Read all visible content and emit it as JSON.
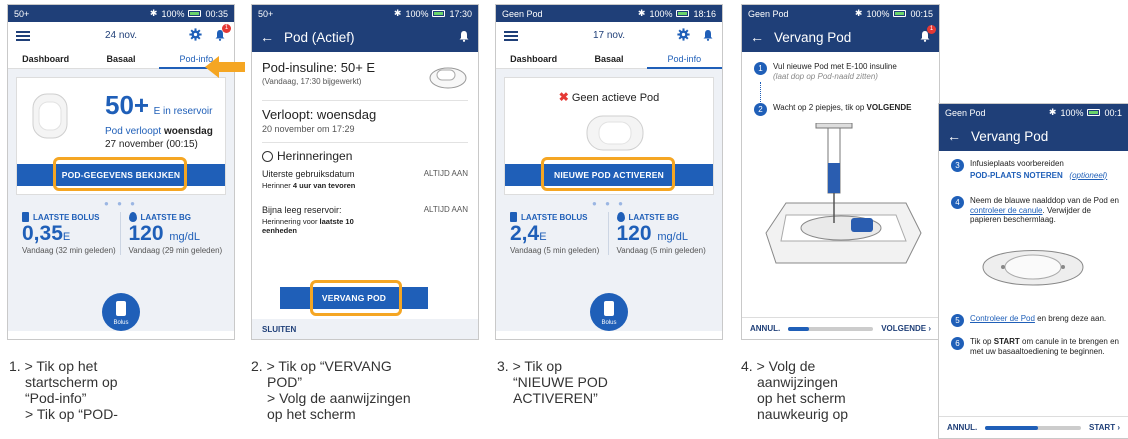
{
  "screen1": {
    "status_left": "50+",
    "status_right": "100%",
    "status_time": "00:35",
    "date": "24 nov.",
    "tabs": [
      "Dashboard",
      "Basaal",
      "Pod-info"
    ],
    "reservoir_value": "50+",
    "reservoir_unit": "E in reservoir",
    "expiry_line1": "Pod verloopt",
    "expiry_day": "woensdag",
    "expiry_line2": "27 november (00:15)",
    "button": "POD-GEGEVENS BEKIJKEN",
    "last_bolus_label": "LAATSTE BOLUS",
    "last_bolus_value": "0,35",
    "last_bolus_unit": "E",
    "last_bolus_sub": "Vandaag (32 min geleden)",
    "last_bg_label": "LAATSTE BG",
    "last_bg_value": "120",
    "last_bg_unit": "mg/dL",
    "last_bg_sub": "Vandaag (29 min geleden)",
    "bolus_label": "Bolus",
    "badge": "1"
  },
  "screen2": {
    "status_left": "50+",
    "status_right": "100%",
    "status_time": "17:30",
    "title": "Pod (Actief)",
    "insulin_line": "Pod-insuline: 50+ E",
    "insulin_sub": "(Vandaag, 17:30 bijgewerkt)",
    "expiry_title": "Verloopt: woensdag",
    "expiry_sub": "20 november om 17:29",
    "reminders_title": "Herinneringen",
    "rem1_title": "Uiterste gebruiksdatum",
    "rem1_value": "ALTIJD AAN",
    "rem1_sub_pre": "Herinner",
    "rem1_sub_bold": "4 uur van tevoren",
    "rem2_title": "Bijna leeg reservoir:",
    "rem2_value": "ALTIJD AAN",
    "rem2_sub_pre": "Herinnering voor",
    "rem2_sub_bold": "laatste 10 eenheden",
    "button": "VERVANG POD",
    "close": "SLUITEN"
  },
  "screen3": {
    "status_left": "Geen Pod",
    "status_right": "100%",
    "status_time": "18:16",
    "date": "17 nov.",
    "tabs": [
      "Dashboard",
      "Basaal",
      "Pod-info"
    ],
    "no_pod": "Geen actieve Pod",
    "button": "NIEUWE POD ACTIVEREN",
    "last_bolus_label": "LAATSTE BOLUS",
    "last_bolus_value": "2,4",
    "last_bolus_unit": "E",
    "last_bolus_sub": "Vandaag (5 min geleden)",
    "last_bg_label": "LAATSTE BG",
    "last_bg_value": "120",
    "last_bg_unit": "mg/dL",
    "last_bg_sub": "Vandaag (5 min geleden)",
    "bolus_label": "Bolus"
  },
  "screen4": {
    "status_left": "Geen Pod",
    "status_right": "100%",
    "status_time": "00:15",
    "title": "Vervang Pod",
    "step1_num": "1",
    "step1": "Vul nieuwe Pod met E-100 insuline",
    "step1_sub": "(laat dop op Pod-naald zitten)",
    "step2_num": "2",
    "step2_pre": "Wacht op 2 piepjes, tik op",
    "step2_bold": "VOLGENDE",
    "cancel": "ANNUL.",
    "next": "VOLGENDE",
    "progress": 0.25,
    "badge": "1"
  },
  "screen5": {
    "status_left": "Geen Pod",
    "status_right": "100%",
    "status_time": "00:1",
    "title": "Vervang Pod",
    "step3_num": "3",
    "step3": "Infusieplaats voorbereiden",
    "step3_bold": "POD-PLAATS NOTEREN",
    "step3_optional": "(optioneel)",
    "step4_num": "4",
    "step4_pre": "Neem de blauwe naalddop van de Pod en",
    "step4_link": "controleer de canule",
    "step4_post": ". Verwijder de papieren beschermlaag.",
    "step5_num": "5",
    "step5_link": "Controleer de Pod",
    "step5_post": "en breng deze aan.",
    "step6_num": "6",
    "step6_pre": "Tik op",
    "step6_bold": "START",
    "step6_post": "om canule in te brengen en met uw basaaltoediening te beginnen.",
    "cancel": "ANNUL.",
    "start": "START",
    "progress": 0.55
  },
  "captions": {
    "c1_a": "1. > Tik op het",
    "c1_b": "startscherm op",
    "c1_c": "“Pod-info”",
    "c1_d": "> Tik op “POD-",
    "c2_a": "2. > Tik op “VERVANG",
    "c2_b": "POD”",
    "c2_c": "> Volg de aanwijzingen",
    "c2_d": "op het scherm",
    "c3_a": "3. > Tik op",
    "c3_b": "“NIEUWE POD",
    "c3_c": "ACTIVEREN”",
    "c4_a": "4. > Volg de",
    "c4_b": "aanwijzingen",
    "c4_c": "op het scherm",
    "c4_d": "nauwkeurig op"
  },
  "colors": {
    "primary": "#1f5fb8",
    "appbar": "#1f3f78",
    "highlight": "#f5a623",
    "error": "#e53935"
  }
}
